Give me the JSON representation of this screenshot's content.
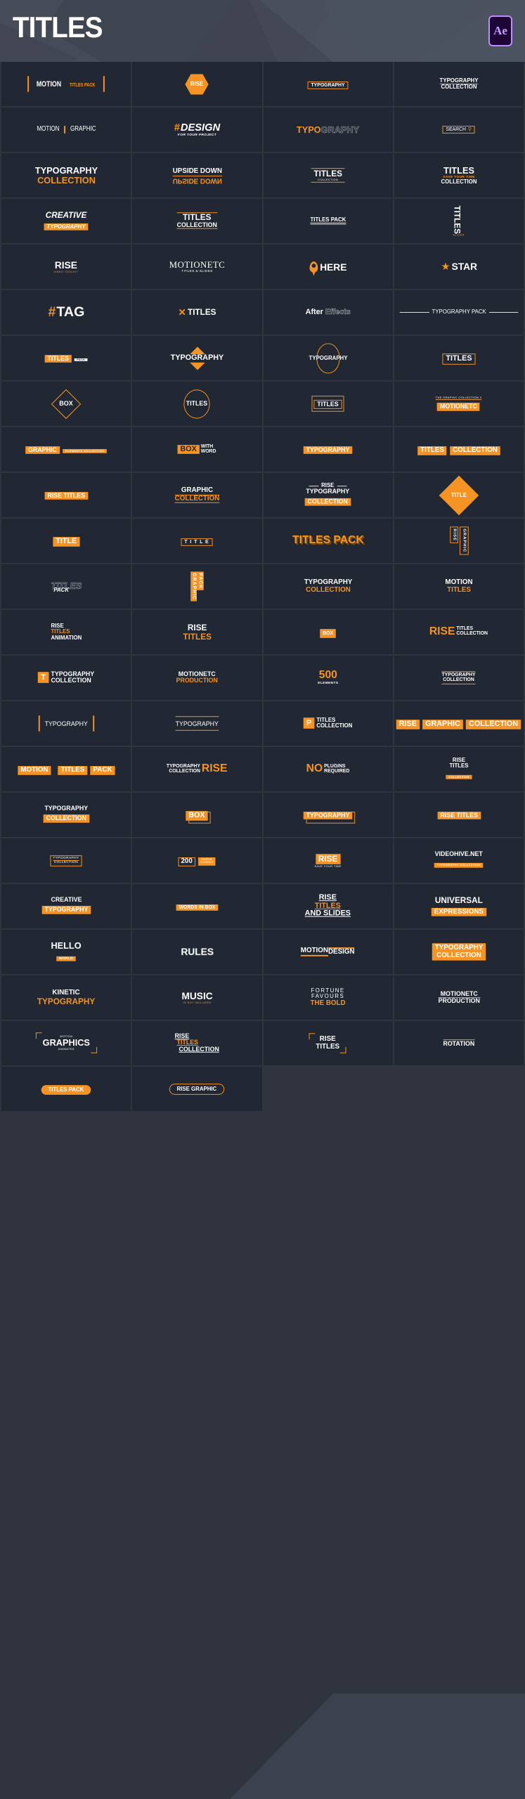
{
  "header": {
    "title": "TITLES",
    "badge": "Ae",
    "badge_name": "after-effects-badge"
  },
  "colors": {
    "accent": "#f59324",
    "cell_bg": "#222833",
    "page_bg": "#2f343e",
    "header_bg": "#454b57",
    "badge_purple": "#bb8bff"
  },
  "grid": {
    "columns": 4,
    "rows": 23,
    "total_cells": 90
  },
  "cells": [
    {
      "id": 1,
      "name": "motion-titles-pack",
      "lines": [
        "MOTION",
        "TITLES PACK"
      ]
    },
    {
      "id": 2,
      "name": "rise-hexagon",
      "lines": [
        "RISE"
      ]
    },
    {
      "id": 3,
      "name": "typography-box",
      "lines": [
        "TYPOGRAPHY"
      ]
    },
    {
      "id": 4,
      "name": "typography-collection",
      "lines": [
        "TYPOGRAPHY",
        "COLLECTION"
      ]
    },
    {
      "id": 5,
      "name": "motion-graphic",
      "lines": [
        "MOTION",
        "GRAPHIC"
      ]
    },
    {
      "id": 6,
      "name": "hash-design",
      "lines": [
        "#",
        "DESIGN",
        "FOR YOUR PROJECT"
      ]
    },
    {
      "id": 7,
      "name": "typography-outline",
      "lines": [
        "TYPO",
        "GRAPHY"
      ]
    },
    {
      "id": 8,
      "name": "search-box",
      "lines": [
        "SEARCH"
      ]
    },
    {
      "id": 9,
      "name": "typography-collection-bold",
      "lines": [
        "TYPOGRAPHY",
        "COLLECTION"
      ]
    },
    {
      "id": 10,
      "name": "upside-down",
      "lines": [
        "UPSIDE DOWN",
        "UPSIDE DOWN"
      ]
    },
    {
      "id": 11,
      "name": "titles-rules",
      "lines": [
        "TITLES",
        "COLLECTION"
      ]
    },
    {
      "id": 12,
      "name": "titles-save-your-time",
      "lines": [
        "TITLES",
        "SAVE YOUR TIME",
        "COLLECTION"
      ]
    },
    {
      "id": 13,
      "name": "creative-typography",
      "lines": [
        "CREATIVE",
        "TYPOGRAPHY"
      ]
    },
    {
      "id": 14,
      "name": "titles-collection-rules",
      "lines": [
        "TITLES",
        "COLLECTION"
      ]
    },
    {
      "id": 15,
      "name": "titles-pack-underline",
      "lines": [
        "TITLES PACK"
      ]
    },
    {
      "id": 16,
      "name": "titles-vertical",
      "lines": [
        "TITLES",
        "SLIDER"
      ]
    },
    {
      "id": 17,
      "name": "rise-video-toolkit",
      "lines": [
        "RISE",
        "VIDEO TOOLKIT"
      ]
    },
    {
      "id": 18,
      "name": "motionetc-titles-slides",
      "lines": [
        "MOTIONETC",
        "TITLES & SLIDES"
      ]
    },
    {
      "id": 19,
      "name": "here-pin",
      "lines": [
        "HERE"
      ]
    },
    {
      "id": 20,
      "name": "star-label",
      "lines": [
        "STAR"
      ]
    },
    {
      "id": 21,
      "name": "hash-tag",
      "lines": [
        "#",
        "TAG"
      ]
    },
    {
      "id": 22,
      "name": "x-titles",
      "lines": [
        "TITLES"
      ]
    },
    {
      "id": 23,
      "name": "after-effects",
      "lines": [
        "After",
        "Effects"
      ]
    },
    {
      "id": 24,
      "name": "typography-pack-line",
      "lines": [
        "TYPOGRAPHY PACK"
      ]
    },
    {
      "id": 25,
      "name": "titles-pack-chip",
      "lines": [
        "TITLES",
        "PACK"
      ]
    },
    {
      "id": 26,
      "name": "typography-triangles",
      "lines": [
        "TYPOGRAPHY"
      ]
    },
    {
      "id": 27,
      "name": "typography-ellipse",
      "lines": [
        "TYPOGRAPHY"
      ]
    },
    {
      "id": 28,
      "name": "titles-outline-box",
      "lines": [
        "TITLES"
      ]
    },
    {
      "id": 29,
      "name": "box-diamond",
      "lines": [
        "BOX"
      ]
    },
    {
      "id": 30,
      "name": "titles-circle",
      "lines": [
        "TITLES"
      ]
    },
    {
      "id": 31,
      "name": "titles-double-box",
      "lines": [
        "TITLES"
      ]
    },
    {
      "id": 32,
      "name": "motionetc-chip",
      "lines": [
        "THE GRAPHIC COLLECTION 2",
        "MOTIONETC"
      ]
    },
    {
      "id": 33,
      "name": "graphic-elements-collection",
      "lines": [
        "GRAPHIC",
        "ELEMENTS COLLECTION"
      ]
    },
    {
      "id": 34,
      "name": "box-with-word",
      "lines": [
        "BOX",
        "WITH",
        "WORD"
      ]
    },
    {
      "id": 35,
      "name": "typography-chip",
      "lines": [
        "TYPOGRAPHY"
      ]
    },
    {
      "id": 36,
      "name": "titles-collection-chips",
      "lines": [
        "TITLES",
        "COLLECTION"
      ]
    },
    {
      "id": 37,
      "name": "rise-titles-chip",
      "lines": [
        "RISE TITLES"
      ]
    },
    {
      "id": 38,
      "name": "graphic-collection",
      "lines": [
        "GRAPHIC",
        "COLLECTION"
      ]
    },
    {
      "id": 39,
      "name": "rise-typography-collection",
      "lines": [
        "RISE",
        "TYPOGRAPHY",
        "COLLECTION"
      ]
    },
    {
      "id": 40,
      "name": "title-diamond",
      "lines": [
        "TITLE"
      ]
    },
    {
      "id": 41,
      "name": "title-chip",
      "lines": [
        "TITLE"
      ]
    },
    {
      "id": 42,
      "name": "title-spaced-box",
      "lines": [
        "T I T L E"
      ]
    },
    {
      "id": 43,
      "name": "titles-pack-3d",
      "lines": [
        "TITLES PACK"
      ]
    },
    {
      "id": 44,
      "name": "rise-graphic-vertical",
      "lines": [
        "RISE",
        "GRAPHIC"
      ]
    },
    {
      "id": 45,
      "name": "titles-pack-outline",
      "lines": [
        "TITLES",
        "PACK"
      ]
    },
    {
      "id": 46,
      "name": "graphic-pack-vertical",
      "lines": [
        "GRAPHIC",
        "PACK"
      ]
    },
    {
      "id": 47,
      "name": "typography-collection-2",
      "lines": [
        "TYPOGRAPHY",
        "COLLECTION"
      ]
    },
    {
      "id": 48,
      "name": "motion-titles",
      "lines": [
        "MOTION",
        "TITLES"
      ]
    },
    {
      "id": 49,
      "name": "rise-titles-animation",
      "lines": [
        "RISE",
        "TITLES",
        "ANIMATION"
      ]
    },
    {
      "id": 50,
      "name": "rise-titles-stack",
      "lines": [
        "RISE",
        "TITLES"
      ]
    },
    {
      "id": 51,
      "name": "box-small-chip",
      "lines": [
        "BOX"
      ]
    },
    {
      "id": 52,
      "name": "rise-titles-collection",
      "lines": [
        "RISE",
        "TITLES",
        "COLLECTION"
      ]
    },
    {
      "id": 53,
      "name": "t-typography-collection",
      "lines": [
        "T",
        "TYPOGRAPHY",
        "COLLECTION"
      ]
    },
    {
      "id": 54,
      "name": "motionetc-production",
      "lines": [
        "MOTIONETC",
        "PRODUCTION"
      ]
    },
    {
      "id": 55,
      "name": "500-elements",
      "lines": [
        "500",
        "ELEMENTS"
      ]
    },
    {
      "id": 56,
      "name": "typography-collection-rules",
      "lines": [
        "TYPOGRAPHY",
        "COLLECTION"
      ]
    },
    {
      "id": 57,
      "name": "typography-brackets",
      "lines": [
        "TYPOGRAPHY"
      ]
    },
    {
      "id": 58,
      "name": "typography-double-rule",
      "lines": [
        "TYPOGRAPHY"
      ]
    },
    {
      "id": 59,
      "name": "p-titles-collection",
      "lines": [
        "P",
        "TITLES",
        "COLLECTION"
      ]
    },
    {
      "id": 60,
      "name": "rise-graphic-collection",
      "lines": [
        "RISE",
        "GRAPHIC",
        "COLLECTION"
      ]
    },
    {
      "id": 61,
      "name": "motion-titles-pack-chips",
      "lines": [
        "MOTION",
        "TITLES",
        "PACK"
      ]
    },
    {
      "id": 62,
      "name": "typography-collection-rise",
      "lines": [
        "TYPOGRAPHY",
        "COLLECTION",
        "RISE"
      ]
    },
    {
      "id": 63,
      "name": "no-plugins-required",
      "lines": [
        "NO",
        "PLUGINS",
        "REQUIRED"
      ]
    },
    {
      "id": 64,
      "name": "rise-titles-collection-2",
      "lines": [
        "RISE",
        "TITLES",
        "COLLECTION"
      ]
    },
    {
      "id": 65,
      "name": "typography-collection-chip",
      "lines": [
        "TYPOGRAPHY",
        "COLLECTION"
      ]
    },
    {
      "id": 66,
      "name": "box-shadow-chip",
      "lines": [
        "BOX"
      ]
    },
    {
      "id": 67,
      "name": "typography-shadow-chip",
      "lines": [
        "TYPOGRAPHY"
      ]
    },
    {
      "id": 68,
      "name": "rise-titles-chip-2",
      "lines": [
        "RISE TITLES"
      ]
    },
    {
      "id": 69,
      "name": "typography-collection-small-box",
      "lines": [
        "TYPOGRAPHY",
        "COLLECTION"
      ]
    },
    {
      "id": 70,
      "name": "200-graphic-elements",
      "lines": [
        "200",
        "GRAPHIC",
        "ELEMENTS"
      ]
    },
    {
      "id": 71,
      "name": "rise-save-your-time",
      "lines": [
        "RISE",
        "SAVE YOUR TIME"
      ]
    },
    {
      "id": 72,
      "name": "videohive-net",
      "lines": [
        "VIDEOHIVE.NET",
        "TYPOGRAPHY COLLECTION"
      ]
    },
    {
      "id": 73,
      "name": "creative-typography-2",
      "lines": [
        "CREATIVE",
        "TYPOGRAPHY"
      ]
    },
    {
      "id": 74,
      "name": "words-in-box",
      "lines": [
        "WORDS IN BOX"
      ]
    },
    {
      "id": 75,
      "name": "rise-titles-and-slides",
      "lines": [
        "RISE",
        "TITLES",
        "AND SLIDES"
      ]
    },
    {
      "id": 76,
      "name": "universal-expressions",
      "lines": [
        "UNIVERSAL",
        "EXPRESSIONS"
      ]
    },
    {
      "id": 77,
      "name": "hello-world",
      "lines": [
        "HELLO",
        "WORLD"
      ]
    },
    {
      "id": 78,
      "name": "rules-outline",
      "lines": [
        "RULES"
      ]
    },
    {
      "id": 79,
      "name": "motion-design",
      "lines": [
        "MOTION",
        "DESIGN"
      ]
    },
    {
      "id": 80,
      "name": "typography-collection-solid",
      "lines": [
        "TYPOGRAPHY",
        "COLLECTION"
      ]
    },
    {
      "id": 81,
      "name": "kinetic-typography",
      "lines": [
        "KINETIC",
        "TYPOGRAPHY"
      ]
    },
    {
      "id": 82,
      "name": "music-not-included",
      "lines": [
        "MUSIC",
        "IS NOT INCLUDED"
      ]
    },
    {
      "id": 83,
      "name": "fortune-favours-the-bold",
      "lines": [
        "FORTUNE",
        "FAVOURS",
        "THE BOLD"
      ]
    },
    {
      "id": 84,
      "name": "motionetc-production-2",
      "lines": [
        "MOTIONETC",
        "PRODUCTION"
      ]
    },
    {
      "id": 85,
      "name": "motion-graphics-animated",
      "lines": [
        "MOTION",
        "GRAPHICS",
        "ANIMATED"
      ]
    },
    {
      "id": 86,
      "name": "rise-titles-collection-3",
      "lines": [
        "RISE",
        "TITLES",
        "COLLECTION"
      ]
    },
    {
      "id": 87,
      "name": "rise-titles-corners",
      "lines": [
        "RISE",
        "TITLES"
      ]
    },
    {
      "id": 88,
      "name": "rotation",
      "lines": [
        "ROTATION"
      ]
    },
    {
      "id": 89,
      "name": "titles-pack-pill",
      "lines": [
        "TITLES PACK"
      ]
    },
    {
      "id": 90,
      "name": "rise-graphic-pill",
      "lines": [
        "RISE GRAPHIC"
      ]
    }
  ]
}
